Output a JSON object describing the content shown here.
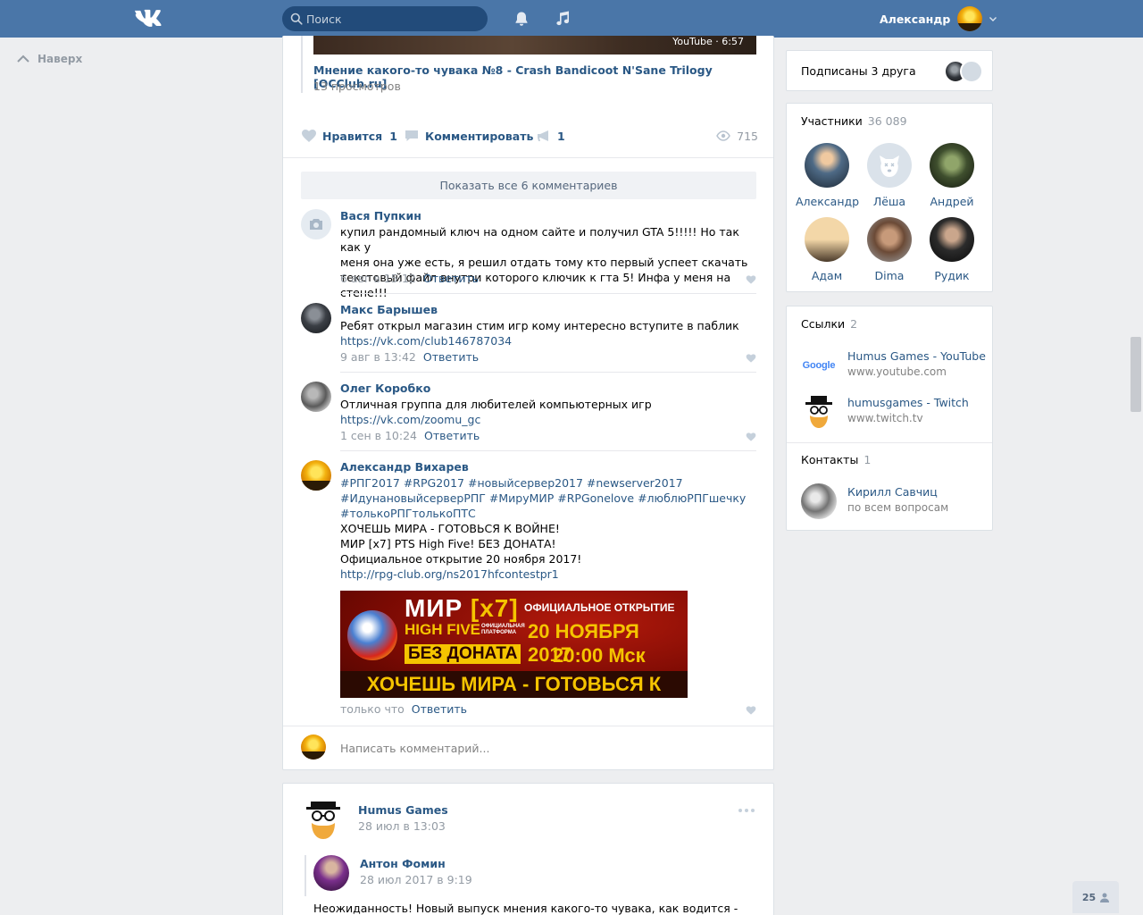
{
  "header": {
    "search_placeholder": "Поиск",
    "user_name": "Александр"
  },
  "leftnav": {
    "top_link": "Наверх"
  },
  "post1": {
    "video": {
      "badge": "YouTube · 6:57",
      "title": "Мнение какого-то чувака №8 - Crash Bandicoot N'Sane Trilogy [OCClub.ru]",
      "views": "13 просмотров"
    },
    "actions": {
      "like_label": "Нравится",
      "like_count": "1",
      "comment_label": "Комментировать",
      "share_count": "1",
      "views": "715"
    },
    "show_all": "Показать все 6 комментариев",
    "comments": [
      {
        "author": "Вася Пупкин",
        "lines": [
          "купил рандомный ключ на одном сайте и получил GTA 5!!!!! Но так как у",
          "меня она уже есть, я решил отдать тому кто первый успеет скачать",
          "текстовый файл внутри которого ключик к гта 5! Инфа у меня на стене!!!"
        ],
        "date": "6 авг в 15:12",
        "reply": "Ответить"
      },
      {
        "author": "Макс Барышев",
        "lines": [
          "Ребят открыл магазин стим игр кому интересно вступите в паблик"
        ],
        "link": "https://vk.com/club146787034",
        "date": "9 авг в 13:42",
        "reply": "Ответить"
      },
      {
        "author": "Олег Коробко",
        "lines": [
          "Отличная группа для любителей компьютерных игр"
        ],
        "link": "https://vk.com/zoomu_gc",
        "date": "1 сен в 10:24",
        "reply": "Ответить"
      },
      {
        "author": "Александр Вихарев",
        "tag_lines": [
          "#РПГ2017 #RPG2017 #новыйсервер2017 #newserver2017",
          "#ИдунановыйсерверРПГ #МируМИР #RPGonelove #люблюРПГшечку",
          "#толькоРПГтолькоПТС"
        ],
        "lines": [
          "ХОЧЕШЬ МИРА - ГОТОВЬСЯ К ВОЙНЕ!",
          "МИР [x7] PTS High Five! БЕЗ ДОНАТА!",
          "Официальное открытие 20 ноября 2017!"
        ],
        "link": "http://rpg-club.org/ns2017hfcontestpr1",
        "date": "только что",
        "reply": "Ответить"
      }
    ],
    "banner": {
      "mir": "МИР",
      "x7": "[x7]",
      "high_five": "HIGH FIVE",
      "platform": "ОФИЦИАЛЬНАЯ ПЛАТФОРМА",
      "no_donate": "БЕЗ ДОНАТА",
      "official_open": "ОФИЦИАЛЬНОЕ ОТКРЫТИЕ",
      "date": "20 НОЯБРЯ 2017",
      "time": "20:00 Мск",
      "slogan": "ХОЧЕШЬ МИРА - ГОТОВЬСЯ К ВОЙНЕ"
    },
    "write_placeholder": "Написать комментарий..."
  },
  "post2": {
    "author": "Humus Games",
    "date": "28 июл в 13:03",
    "repost_author": "Антон Фомин",
    "repost_date": "28 июл 2017 в 9:19",
    "text": "Неожиданность! Новый выпуск мнения какого-то чувака, как водится -"
  },
  "sidebar": {
    "subscribed": "Подписаны 3 друга",
    "members_title": "Участники",
    "members_count": "36 089",
    "members": [
      {
        "name": "Александр"
      },
      {
        "name": "Лёша"
      },
      {
        "name": "Андрей"
      },
      {
        "name": "Адам"
      },
      {
        "name": "Dima"
      },
      {
        "name": "Рудик"
      }
    ],
    "links_title": "Ссылки",
    "links_count": "2",
    "links": [
      {
        "title": "Humus Games - YouTube",
        "url": "www.youtube.com",
        "icon_text": "Google"
      },
      {
        "title": "humusgames - Twitch",
        "url": "www.twitch.tv"
      }
    ],
    "contacts_title": "Контакты",
    "contacts_count": "1",
    "contact": {
      "name": "Кирилл Савчиц",
      "role": "по всем вопросам"
    }
  },
  "online_count": "25",
  "colors": {
    "header": "#4a76a8",
    "link": "#2a5885",
    "muted": "#939ba4",
    "background": "#edeef0"
  }
}
